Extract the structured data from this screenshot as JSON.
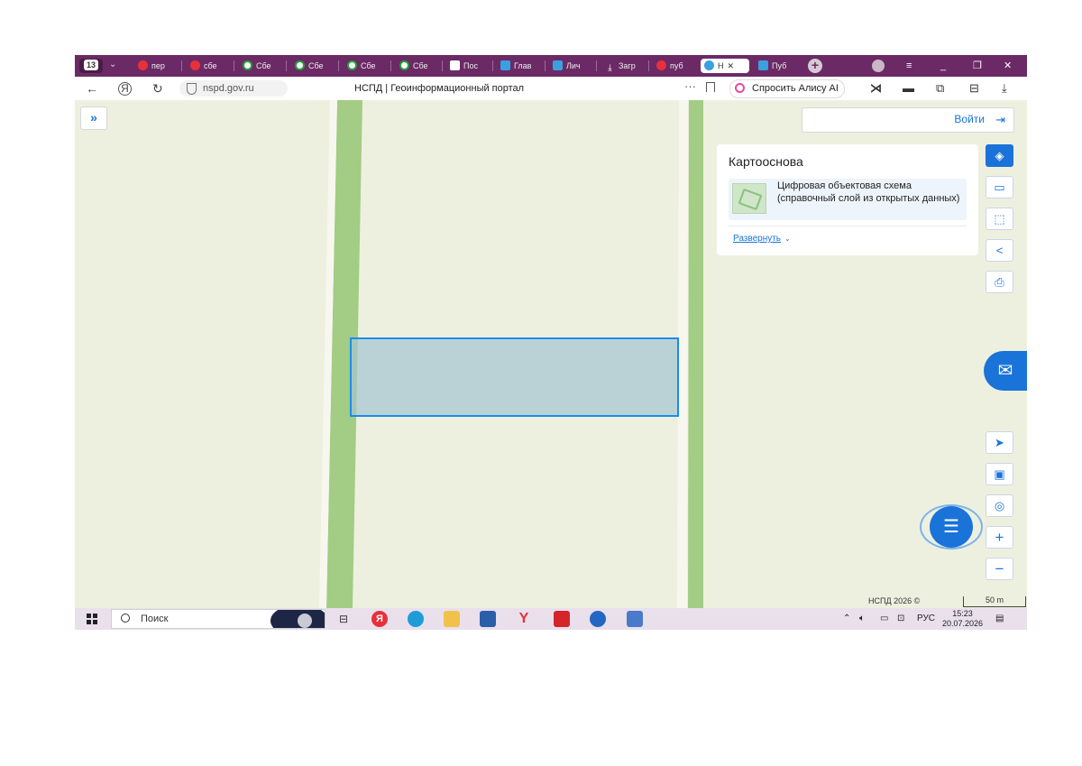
{
  "browser": {
    "tab_count": "13",
    "tabs": [
      {
        "label": "пер",
        "icon": "yandex-icon",
        "color": "#e8303a"
      },
      {
        "label": "сбе",
        "icon": "yandex-icon",
        "color": "#e8303a"
      },
      {
        "label": "Сбе",
        "icon": "sber-icon",
        "color": "#21a038"
      },
      {
        "label": "Сбе",
        "icon": "sber-icon",
        "color": "#21a038"
      },
      {
        "label": "Сбе",
        "icon": "sber-icon",
        "color": "#21a038"
      },
      {
        "label": "Сбе",
        "icon": "sber-icon",
        "color": "#21a038"
      },
      {
        "label": "Пос",
        "icon": "doc-icon",
        "color": "#d9e3f5"
      },
      {
        "label": "Глав",
        "icon": "gosuslugi-icon",
        "color": "#3aa0e0"
      },
      {
        "label": "Лич",
        "icon": "gosuslugi-icon",
        "color": "#3aa0e0"
      },
      {
        "label": "Загр",
        "icon": "download-icon",
        "color": "#ffffff"
      },
      {
        "label": "пуб",
        "icon": "yandex-icon",
        "color": "#e8303a"
      },
      {
        "label": "Н",
        "icon": "nspd-icon",
        "color": "#3aa0e0",
        "active": true
      },
      {
        "label": "Пуб",
        "icon": "plus-cross-icon",
        "color": "#3aa0e0"
      }
    ],
    "url": "nspd.gov.ru",
    "page_title": "НСПД | Геоинформационный портал",
    "alice_label": "Спросить Алису AI"
  },
  "map": {
    "login_label": "Войти",
    "panel": {
      "title": "Картооснова",
      "layer_name": "Цифровая объектовая схема (справочный слой из открытых данных)",
      "expand_label": "Развернуть"
    },
    "copyright": "НСПД 2026 ©",
    "scale_label": "50 m"
  },
  "taskbar": {
    "search_placeholder": "Поиск",
    "lang": "РУС",
    "time": "15:23",
    "date": "20.07.2026"
  },
  "colors": {
    "map_background": "#eef0df",
    "road_green": "#a3cc84",
    "parcel_fill": "#b7cfd6",
    "parcel_border": "#1a8cf0",
    "accent": "#1a73d9",
    "browser_tabbar": "#6b2a66"
  }
}
